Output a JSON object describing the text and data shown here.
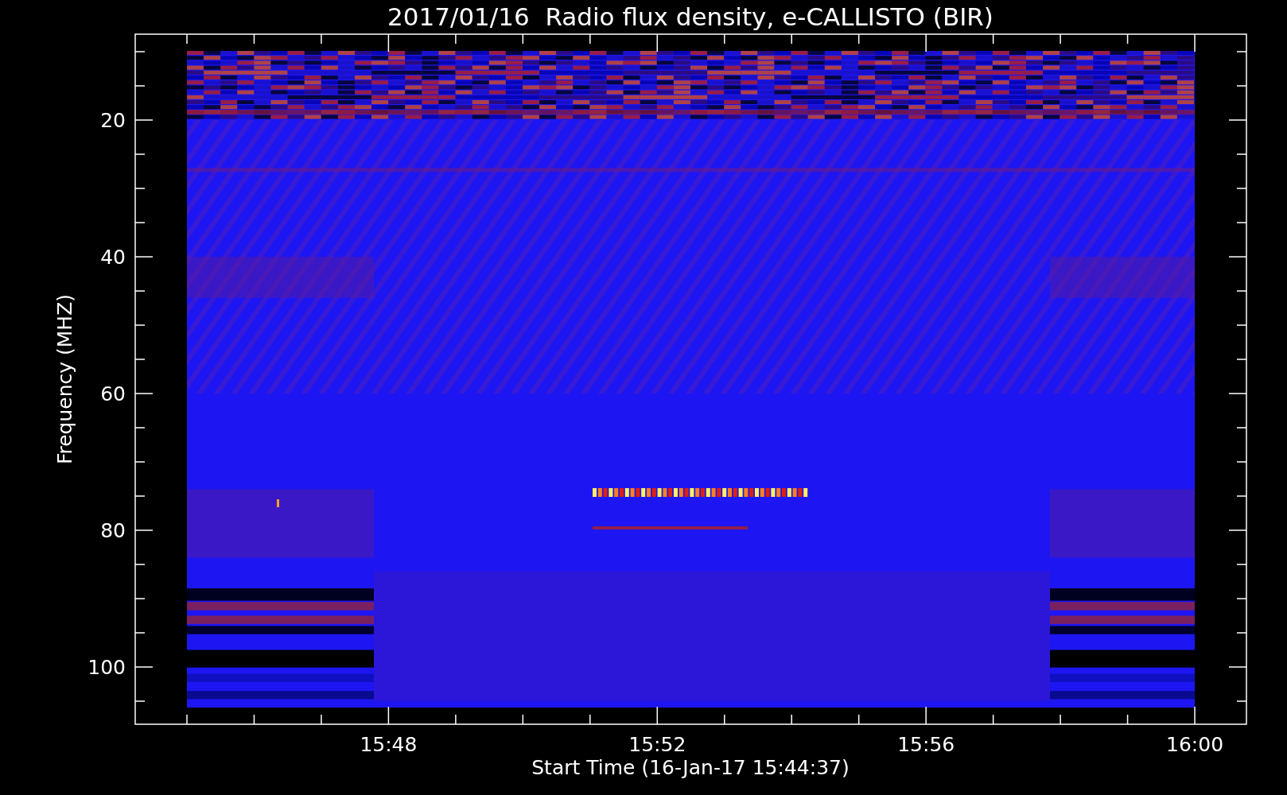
{
  "title": "2017/01/16  Radio flux density, e-CALLISTO (BIR)",
  "y_axis": {
    "label": "Frequency (MHZ)",
    "ticks": [
      "20",
      "40",
      "60",
      "80",
      "100"
    ]
  },
  "x_axis": {
    "label": "Start Time (16-Jan-17 15:44:37)",
    "ticks": [
      "15:48",
      "15:52",
      "15:56",
      "16:00"
    ]
  }
}
